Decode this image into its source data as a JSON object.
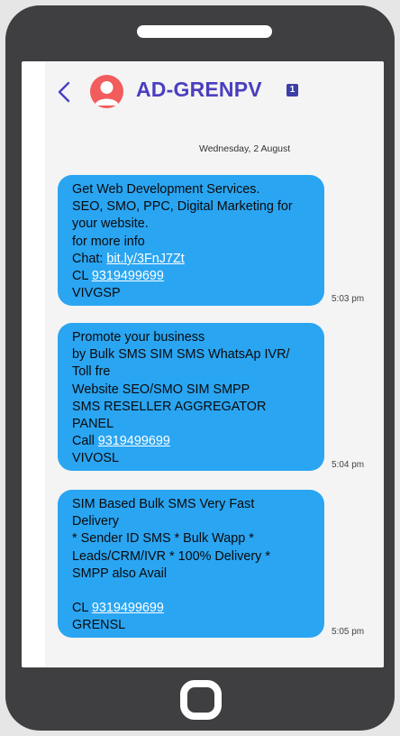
{
  "header": {
    "sender": "AD-GRENPV",
    "sim_badge": "1"
  },
  "date_label": "Wednesday, 2 August",
  "messages": [
    {
      "lines": [
        "Get Web Development Services.",
        "SEO, SMO, PPC, Digital Marketing for",
        "your website.",
        "for more info"
      ],
      "chat_prefix": "Chat: ",
      "chat_link": "bit.ly/3FnJ7Zt",
      "call_prefix": "CL ",
      "phone": "9319499699",
      "signature": "VIVGSP",
      "time": "5:03 pm"
    },
    {
      "lines": [
        "Promote your business",
        "by Bulk SMS SIM SMS WhatsAp IVR/",
        "Toll fre",
        "Website SEO/SMO SIM SMPP",
        "SMS RESELLER AGGREGATOR",
        "PANEL"
      ],
      "call_prefix": "Call ",
      "phone": "9319499699",
      "signature": "VIVOSL",
      "time": "5:04 pm"
    },
    {
      "lines": [
        "SIM Based Bulk SMS Very Fast",
        "Delivery",
        "* Sender ID SMS * Bulk Wapp *",
        "Leads/CRM/IVR * 100% Delivery *",
        "SMPP also Avail"
      ],
      "call_prefix": "CL ",
      "phone": "9319499699",
      "signature": "GRENSL",
      "time": "5:05 pm"
    }
  ],
  "colors": {
    "bubble": "#2aa5f2",
    "sender_name": "#4a3fbf",
    "avatar": "#f25c5c",
    "phone_body": "#3f3f41"
  }
}
